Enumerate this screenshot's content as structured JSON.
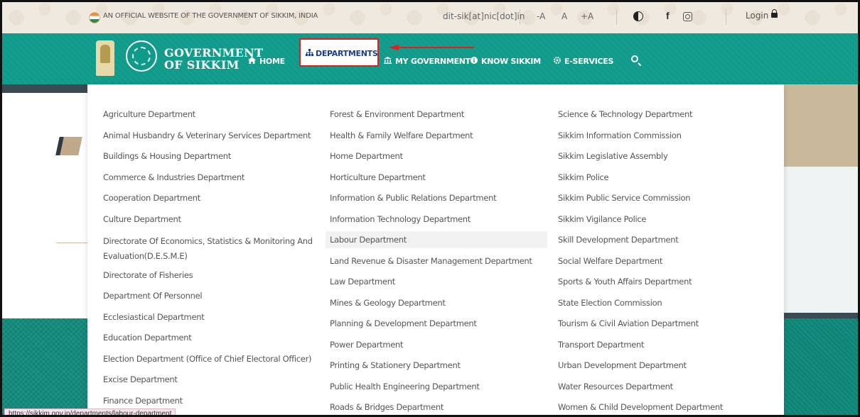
{
  "topbar": {
    "official_text": "AN OFFICIAL WEBSITE OF THE GOVERNMENT OF SIKKIM, INDIA",
    "email": "dit-sik[at]nic[dot]in",
    "font_small": "-A",
    "font_normal": "A",
    "font_large": "+A",
    "login": "Login"
  },
  "brand": {
    "line1": "GOVERNMENT",
    "line2": "OF SIKKIM"
  },
  "nav": {
    "home": "HOME",
    "departments": "DEPARTMENTS",
    "my_government": "MY GOVERNMENT",
    "know_sikkim": "KNOW SIKKIM",
    "e_services": "E-SERVICES"
  },
  "departments": {
    "col1": [
      "Agriculture Department",
      "Animal Husbandry & Veterinary Services Department",
      "Buildings & Housing Department",
      "Commerce & Industries Department",
      "Cooperation Department",
      "Culture Department",
      "Directorate Of Economics, Statistics & Monitoring And Evaluation(D.E.S.M.E)",
      "Directorate of Fisheries",
      "Department Of Personnel",
      "Ecclesiastical Department",
      "Education Department",
      "Election Department (Office of Chief Electoral Officer)",
      "Excise Department",
      "Finance Department"
    ],
    "col2": [
      "Forest & Environment Department",
      "Health & Family Welfare Department",
      "Home Department",
      "Horticulture Department",
      "Information & Public Relations Department",
      "Information Technology Department",
      "Labour Department",
      "Land Revenue & Disaster Management Department",
      "Law Department",
      "Mines & Geology Department",
      "Planning & Development Department",
      "Power Department",
      "Printing & Stationery Department",
      "Public Health Engineering Department",
      "Roads & Bridges Department"
    ],
    "col3": [
      "Science & Technology Department",
      "Sikkim Information Commission",
      "Sikkim Legislative Assembly",
      "Sikkim Police",
      "Sikkim Public Service Commission",
      "Sikkim Vigilance Police",
      "Skill Development Department",
      "Social Welfare Department",
      "Sports & Youth Affairs Department",
      "State Election Commission",
      "Tourism & Civil Aviation Department",
      "Transport Department",
      "Urban Development Department",
      "Water Resources Department",
      "Women & Child Development Department"
    ]
  },
  "status_url": "https://sikkim.gov.in/departments/labour-department",
  "colors": {
    "nav_bg": "#0f9a8a",
    "highlight": "#e02020",
    "dept_text": "#1a3d8f"
  }
}
